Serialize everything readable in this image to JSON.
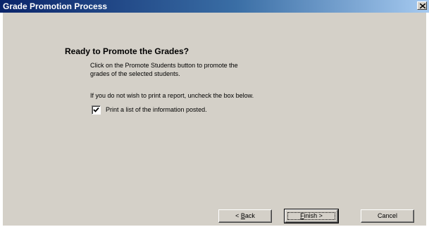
{
  "window": {
    "title": "Grade Promotion Process"
  },
  "content": {
    "heading": "Ready to Promote the Grades?",
    "instruction_line1": "Click on the Promote Students button to promote the",
    "instruction_line2": "grades of the selected students.",
    "print_note": "If you do not wish to print a report, uncheck the box below.",
    "print_checkbox": {
      "label": "Print a list of the information posted.",
      "checked": true
    }
  },
  "buttons": {
    "back": {
      "prefix": "< ",
      "mnemonic": "B",
      "rest": "ack"
    },
    "finish": {
      "mnemonic": "F",
      "rest": "inish >"
    },
    "cancel": "Cancel"
  },
  "icons": {
    "close": "close-icon",
    "check": "checkmark-icon"
  },
  "colors": {
    "titlebar": "#0a246a",
    "dialog_face": "#d4d0c8"
  }
}
